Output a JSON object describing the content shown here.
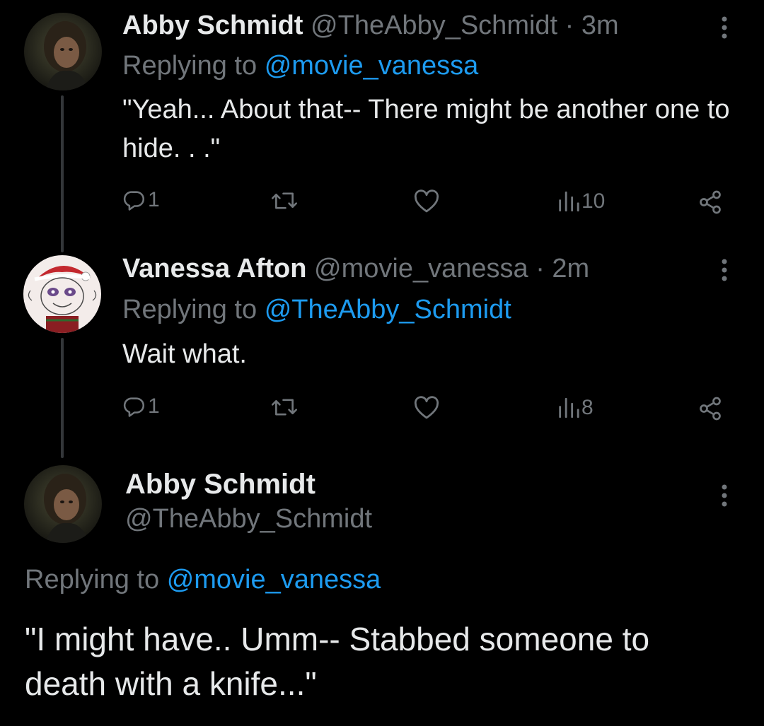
{
  "thread": [
    {
      "author_name": "Abby Schmidt",
      "handle": "@TheAbby_Schmidt",
      "separator": "·",
      "time": "3m",
      "replying_prefix": "Replying to",
      "replying_to": "@movie_vanessa",
      "text": "\"Yeah... About that-- There might be another one to hide. . .\"",
      "replies": "1",
      "views": "10",
      "avatar_icon": "dark-portrait-avatar"
    },
    {
      "author_name": "Vanessa Afton",
      "handle": "@movie_vanessa",
      "separator": "·",
      "time": "2m",
      "replying_prefix": "Replying to",
      "replying_to": "@TheAbby_Schmidt",
      "text": "Wait what.",
      "replies": "1",
      "views": "8",
      "avatar_icon": "sketch-face-avatar"
    }
  ],
  "main_tweet": {
    "author_name": "Abby Schmidt",
    "handle": "@TheAbby_Schmidt",
    "replying_prefix": "Replying to",
    "replying_to": "@movie_vanessa",
    "text": "\"I might have.. Umm-- Stabbed someone to death with a knife...\""
  },
  "colors": {
    "background": "#000000",
    "text": "#e7e9ea",
    "muted": "#71767b",
    "link": "#1d9bf0",
    "thread_line": "#333639"
  },
  "icons": {
    "reply": "reply-bubble-icon",
    "retweet": "retweet-icon",
    "like": "heart-icon",
    "views": "views-bar-chart-icon",
    "share": "share-icon",
    "more": "more-vertical-icon"
  }
}
